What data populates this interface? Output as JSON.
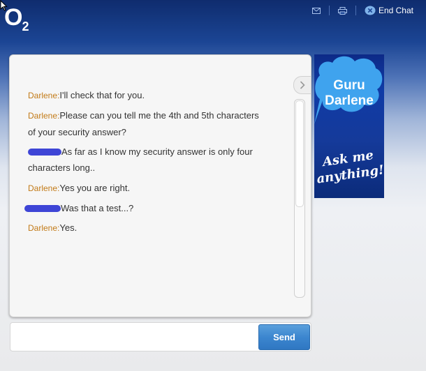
{
  "header": {
    "logo_main": "O",
    "logo_sub": "2",
    "end_chat_label": "End Chat",
    "email_icon": "email-icon",
    "print_icon": "print-icon",
    "end_chat_icon": "close-circle-icon"
  },
  "messages": [
    {
      "speaker": "Darlene:",
      "redacted": false,
      "text": "I'll check that for you."
    },
    {
      "speaker": "Darlene:",
      "redacted": false,
      "text": "Please can you tell me the 4th and 5th characters",
      "text2": "of your security answer?"
    },
    {
      "speaker": "",
      "redacted": true,
      "text": "As far as I know my security answer is only four",
      "text2": "characters long.."
    },
    {
      "speaker": "Darlene:",
      "redacted": false,
      "text": "Yes you are right."
    },
    {
      "speaker": "",
      "redacted": true,
      "text": "Was that a test...?"
    },
    {
      "speaker": "Darlene:",
      "redacted": false,
      "text": "Yes."
    }
  ],
  "ad": {
    "title_line1": "Guru",
    "title_line2": "Darlene",
    "tag_line1": "Ask me",
    "tag_line2": "anything!"
  },
  "composer": {
    "input_value": "",
    "send_label": "Send"
  },
  "colors": {
    "speaker": "#c27a17",
    "send": "#3c86cf",
    "redaction": "#3e45d6"
  }
}
